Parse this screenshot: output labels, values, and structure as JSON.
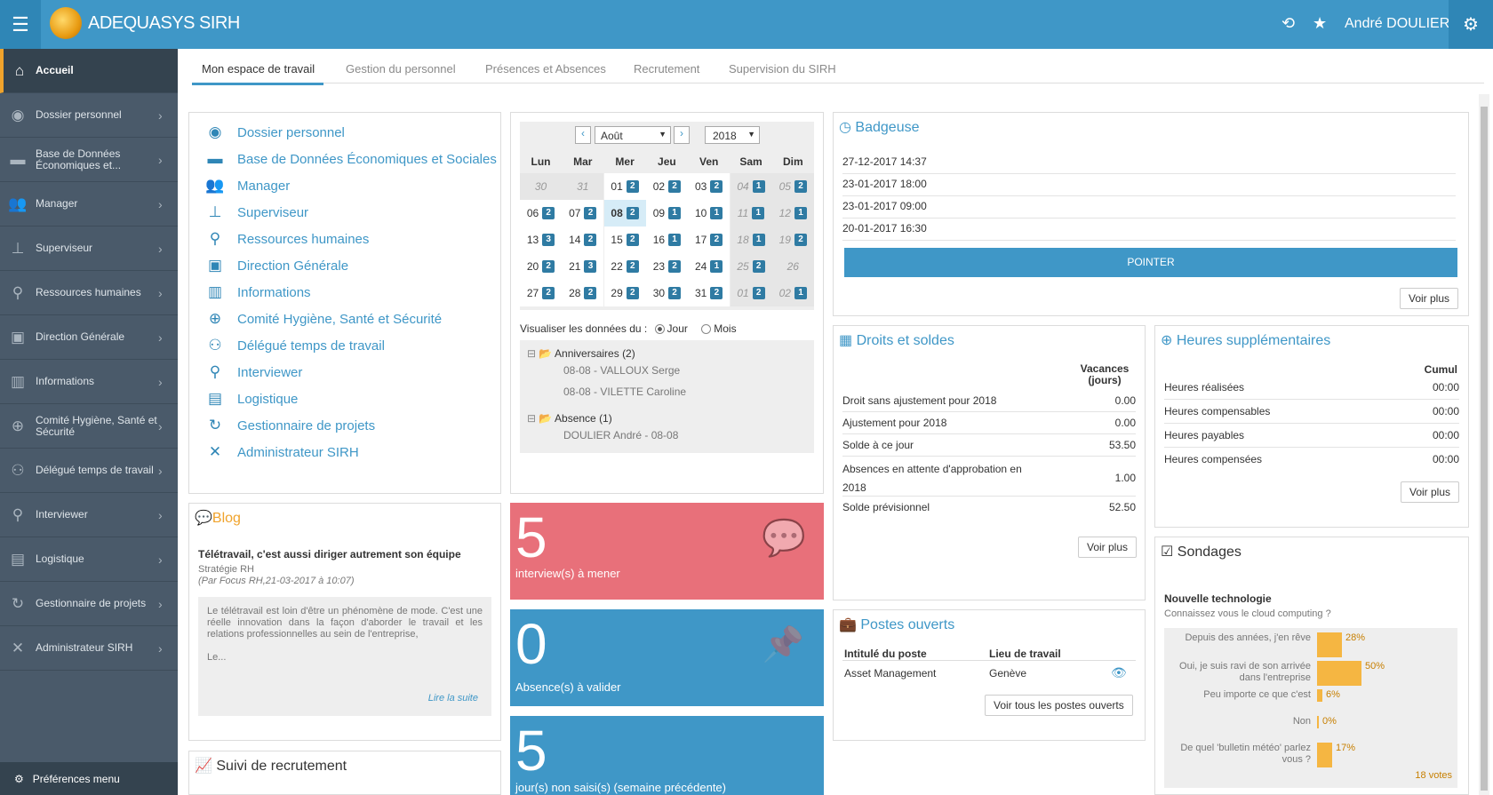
{
  "app": {
    "brand": "ADEQUASYS SIRH",
    "user": "André DOULIER"
  },
  "sidebar": {
    "items": [
      {
        "label": "Accueil",
        "icon": "home-icon"
      },
      {
        "label": "Dossier personnel",
        "icon": "user-circle-icon"
      },
      {
        "label": "Base de Données Économiques et...",
        "icon": "folder-icon"
      },
      {
        "label": "Manager",
        "icon": "users-icon"
      },
      {
        "label": "Superviseur",
        "icon": "sitemap-icon"
      },
      {
        "label": "Ressources humaines",
        "icon": "org-icon"
      },
      {
        "label": "Direction Générale",
        "icon": "id-card-icon"
      },
      {
        "label": "Informations",
        "icon": "building-icon"
      },
      {
        "label": "Comité Hygiène, Santé et Sécurité",
        "icon": "plus-square-icon"
      },
      {
        "label": "Délégué temps de travail",
        "icon": "group-icon"
      },
      {
        "label": "Interviewer",
        "icon": "interview-icon"
      },
      {
        "label": "Logistique",
        "icon": "briefcase-icon"
      },
      {
        "label": "Gestionnaire de projets",
        "icon": "project-icon"
      },
      {
        "label": "Administrateur SIRH",
        "icon": "tools-icon"
      }
    ],
    "footer": "Préférences menu"
  },
  "tabs": [
    "Mon espace de travail",
    "Gestion du personnel",
    "Présences et Absences",
    "Recrutement",
    "Supervision du SIRH"
  ],
  "links": [
    "Dossier personnel",
    "Base de Données Économiques et Sociales",
    "Manager",
    "Superviseur",
    "Ressources humaines",
    "Direction Générale",
    "Informations",
    "Comité Hygiène, Santé et Sécurité",
    "Délégué temps de travail",
    "Interviewer",
    "Logistique",
    "Gestionnaire de projets",
    "Administrateur SIRH"
  ],
  "calendar": {
    "month": "Août",
    "year": "2018",
    "days": [
      "Lun",
      "Mar",
      "Mer",
      "Jeu",
      "Ven",
      "Sam",
      "Dim"
    ],
    "weeks": [
      [
        [
          "30",
          ""
        ],
        [
          "31",
          ""
        ],
        [
          "01",
          "2"
        ],
        [
          "02",
          "2"
        ],
        [
          "03",
          "2"
        ],
        [
          "04",
          "1"
        ],
        [
          "05",
          "2"
        ]
      ],
      [
        [
          "06",
          "2"
        ],
        [
          "07",
          "2"
        ],
        [
          "08",
          "2"
        ],
        [
          "09",
          "1"
        ],
        [
          "10",
          "1"
        ],
        [
          "11",
          "1"
        ],
        [
          "12",
          "1"
        ]
      ],
      [
        [
          "13",
          "3"
        ],
        [
          "14",
          "2"
        ],
        [
          "15",
          "2"
        ],
        [
          "16",
          "1"
        ],
        [
          "17",
          "2"
        ],
        [
          "18",
          "1"
        ],
        [
          "19",
          "2"
        ]
      ],
      [
        [
          "20",
          "2"
        ],
        [
          "21",
          "3"
        ],
        [
          "22",
          "2"
        ],
        [
          "23",
          "2"
        ],
        [
          "24",
          "1"
        ],
        [
          "25",
          "2"
        ],
        [
          "26",
          ""
        ]
      ],
      [
        [
          "27",
          "2"
        ],
        [
          "28",
          "2"
        ],
        [
          "29",
          "2"
        ],
        [
          "30",
          "2"
        ],
        [
          "31",
          "2"
        ],
        [
          "01",
          "2"
        ],
        [
          "02",
          "1"
        ]
      ]
    ],
    "view_label": "Visualiser les données du :",
    "opt_day": "Jour",
    "opt_month": "Mois",
    "tree": {
      "anniv": "Anniversaires (2)",
      "anniv_items": [
        "08-08 - VALLOUX Serge",
        "08-08 - VILETTE Caroline"
      ],
      "absence": "Absence (1)",
      "absence_items": [
        "DOULIER André - 08-08"
      ]
    }
  },
  "badgeuse": {
    "title": "Badgeuse",
    "entries": [
      "27-12-2017 14:37",
      "23-01-2017 18:00",
      "23-01-2017 09:00",
      "20-01-2017 16:30"
    ],
    "button": "POINTER",
    "more": "Voir plus"
  },
  "droits": {
    "title": "Droits et soldes",
    "col": "Vacances (jours)",
    "rows": [
      [
        "Droit sans ajustement pour 2018",
        "0.00"
      ],
      [
        "Ajustement pour 2018",
        "0.00"
      ],
      [
        "Solde à ce jour",
        "53.50"
      ],
      [
        "Absences en attente d'approbation en 2018",
        "1.00"
      ],
      [
        "Solde prévisionnel",
        "52.50"
      ]
    ],
    "more": "Voir plus"
  },
  "heures": {
    "title": "Heures supplémentaires",
    "col": "Cumul",
    "rows": [
      [
        "Heures réalisées",
        "00:00"
      ],
      [
        "Heures compensables",
        "00:00"
      ],
      [
        "Heures payables",
        "00:00"
      ],
      [
        "Heures compensées",
        "00:00"
      ]
    ],
    "more": "Voir plus"
  },
  "blog": {
    "title": "Blog",
    "post_title": "Télétravail, c'est aussi diriger autrement son équipe",
    "category": "Stratégie RH",
    "meta": "(Par Focus RH,21-03-2017 à 10:07)",
    "excerpt": "Le télétravail est loin d'être un phénomène de mode. C'est une réelle innovation dans la façon d'aborder le travail et les relations professionnelles au sein de l'entreprise,",
    "more_dots": "Le...",
    "read_more": "Lire la suite"
  },
  "tiles": [
    {
      "num": "5",
      "label": "interview(s) à mener",
      "color": "#e8707a"
    },
    {
      "num": "0",
      "label": "Absence(s) à valider",
      "color": "#3f97c7"
    },
    {
      "num": "5",
      "label": "jour(s) non saisi(s) (semaine précédente)",
      "color": "#3f97c7"
    }
  ],
  "postes": {
    "title": "Postes ouverts",
    "col1": "Intitulé du poste",
    "col2": "Lieu de travail",
    "rows": [
      [
        "Asset Management",
        "Genève"
      ]
    ],
    "button": "Voir tous les postes ouverts"
  },
  "recrutement": {
    "title": "Suivi de recrutement"
  },
  "sondages": {
    "title": "Sondages",
    "question_title": "Nouvelle technologie",
    "question": "Connaissez vous le cloud computing ?",
    "votes": "18 votes",
    "answers": [
      {
        "label": "Depuis des années, j'en rêve",
        "pct": "28%",
        "value": 28
      },
      {
        "label": "Oui, je suis ravi de son arrivée dans l'entreprise",
        "pct": "50%",
        "value": 50
      },
      {
        "label": "Peu importe ce que c'est",
        "pct": "6%",
        "value": 6
      },
      {
        "label": "Non",
        "pct": "0%",
        "value": 0
      },
      {
        "label": "De quel 'bulletin météo' parlez vous ?",
        "pct": "17%",
        "value": 17
      }
    ]
  }
}
